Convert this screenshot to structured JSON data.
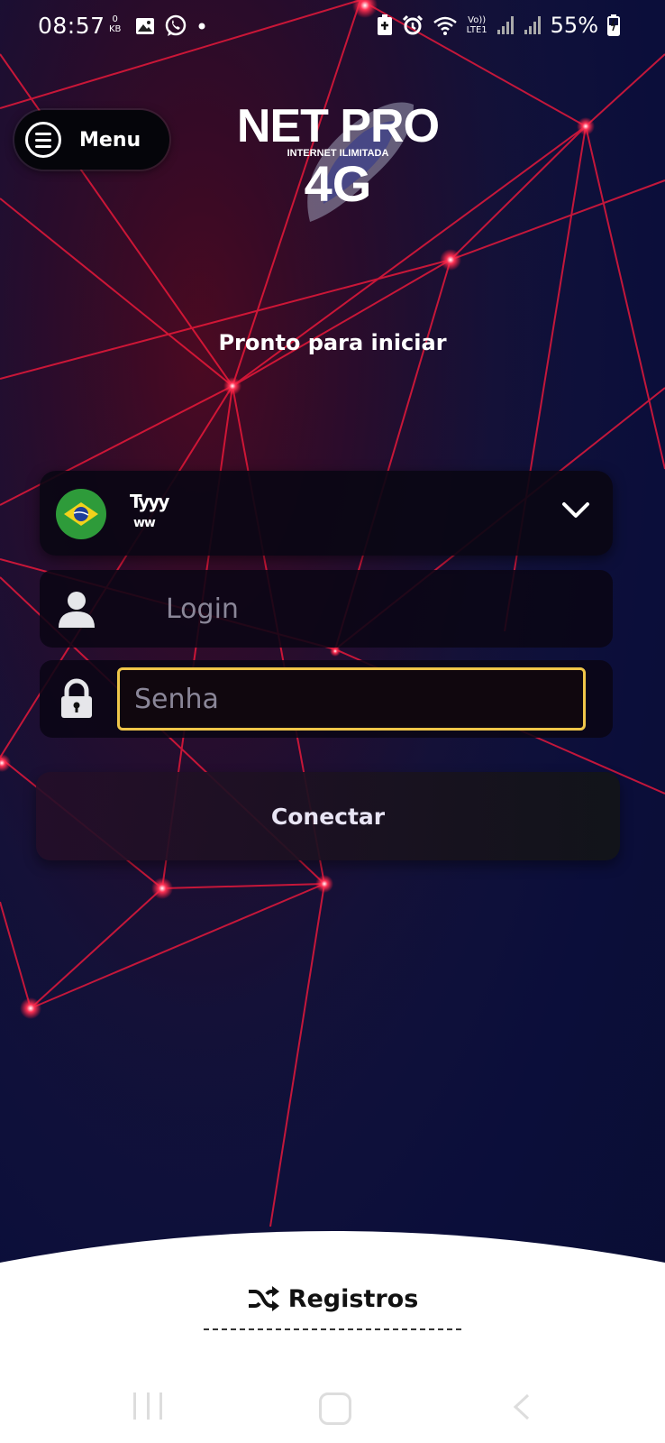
{
  "status_bar": {
    "time": "08:57",
    "data_speed_value": "0",
    "data_speed_unit": "KB",
    "network_label": "LTE1",
    "volte_label": "Vo))",
    "battery": "55%",
    "icons": [
      "gallery-icon",
      "whatsapp-icon",
      "dot-icon",
      "battery-saver-icon",
      "alarm-icon",
      "wifi-icon",
      "signal-icon",
      "battery-icon"
    ]
  },
  "header": {
    "menu_label": "Menu",
    "logo_title": "NET PRO",
    "logo_subtitle": "INTERNET ILIMITADA",
    "logo_badge": "4G"
  },
  "main": {
    "status_message": "Pronto para iniciar",
    "server": {
      "name": "Tyyy",
      "sub": "ww",
      "flag": "brazil-flag"
    },
    "login_placeholder": "Login",
    "password_placeholder": "Senha",
    "connect_label": "Conectar"
  },
  "footer": {
    "registros_label": "Registros"
  },
  "colors": {
    "background": "#0a0d33",
    "accent_red": "#ff1a3c",
    "focus_border": "#f0c64a",
    "flag_green": "#2e9b3a"
  }
}
